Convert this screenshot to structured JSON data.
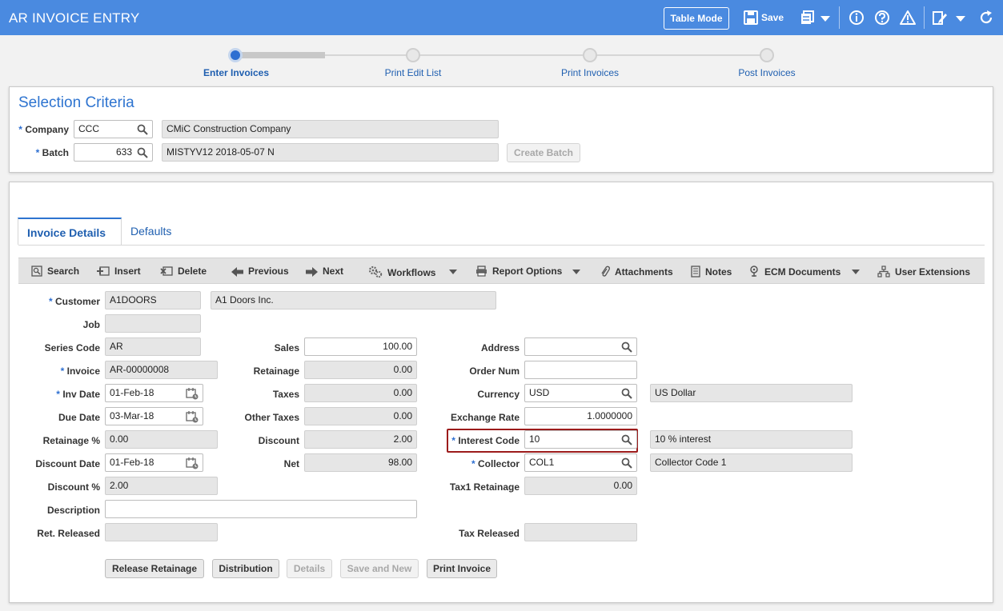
{
  "app": {
    "title": "AR INVOICE ENTRY"
  },
  "header": {
    "table_mode": "Table Mode",
    "save": "Save"
  },
  "stepper": [
    {
      "label": "Enter Invoices",
      "active": true
    },
    {
      "label": "Print Edit List",
      "active": false
    },
    {
      "label": "Print Invoices",
      "active": false
    },
    {
      "label": "Post Invoices",
      "active": false
    }
  ],
  "selection": {
    "title": "Selection Criteria",
    "company_label": "Company",
    "company_value": "CCC",
    "company_name": "CMiC Construction Company",
    "batch_label": "Batch",
    "batch_value": "633",
    "batch_desc": "MISTYV12 2018-05-07 N",
    "create_batch": "Create Batch"
  },
  "tabs": {
    "invoice_details": "Invoice Details",
    "defaults": "Defaults"
  },
  "toolbar": {
    "search": "Search",
    "insert": "Insert",
    "delete": "Delete",
    "previous": "Previous",
    "next": "Next",
    "workflows": "Workflows",
    "report_options": "Report Options",
    "attachments": "Attachments",
    "notes": "Notes",
    "ecm_documents": "ECM Documents",
    "user_extensions": "User Extensions"
  },
  "form": {
    "customer_label": "Customer",
    "customer": "A1DOORS",
    "customer_name": "A1 Doors Inc.",
    "job_label": "Job",
    "job": "",
    "series_code_label": "Series Code",
    "series_code": "AR",
    "invoice_label": "Invoice",
    "invoice": "AR-00000008",
    "inv_date_label": "Inv Date",
    "inv_date": "01-Feb-18",
    "due_date_label": "Due Date",
    "due_date": "03-Mar-18",
    "retainage_pct_label": "Retainage %",
    "retainage_pct": "0.00",
    "discount_date_label": "Discount Date",
    "discount_date": "01-Feb-18",
    "discount_pct_label": "Discount %",
    "discount_pct": "2.00",
    "description_label": "Description",
    "description": "",
    "ret_released_label": "Ret. Released",
    "ret_released": "",
    "sales_label": "Sales",
    "sales": "100.00",
    "retainage_label": "Retainage",
    "retainage": "0.00",
    "taxes_label": "Taxes",
    "taxes": "0.00",
    "other_taxes_label": "Other Taxes",
    "other_taxes": "0.00",
    "discount_label": "Discount",
    "discount": "2.00",
    "net_label": "Net",
    "net": "98.00",
    "address_label": "Address",
    "address": "",
    "order_num_label": "Order Num",
    "order_num": "",
    "currency_label": "Currency",
    "currency": "USD",
    "currency_name": "US Dollar",
    "exchange_rate_label": "Exchange Rate",
    "exchange_rate": "1.0000000",
    "interest_code_label": "Interest Code",
    "interest_code": "10",
    "interest_code_name": "10 % interest",
    "collector_label": "Collector",
    "collector": "COL1",
    "collector_name": "Collector Code 1",
    "tax1_retainage_label": "Tax1 Retainage",
    "tax1_retainage": "0.00",
    "tax_released_label": "Tax Released",
    "tax_released": ""
  },
  "actions": {
    "release_retainage": "Release Retainage",
    "distribution": "Distribution",
    "details": "Details",
    "save_and_new": "Save and New",
    "print_invoice": "Print Invoice"
  },
  "required_marker": "*",
  "colors": {
    "header": "#4a8ae0",
    "accent": "#2e74d0",
    "highlight": "#9c1b1b"
  }
}
